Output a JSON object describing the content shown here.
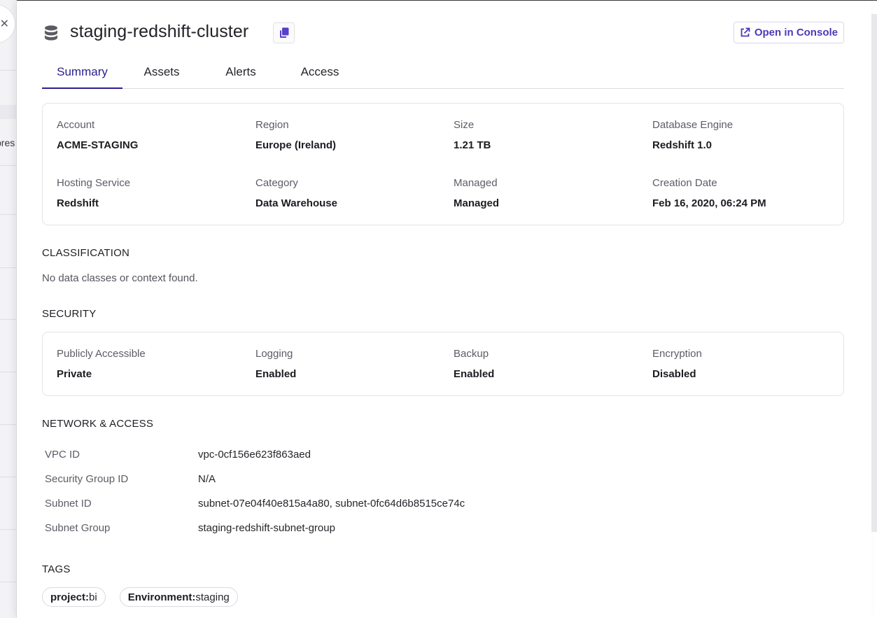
{
  "background": {
    "truncated_text": "pres"
  },
  "drawer": {
    "title": "staging-redshift-cluster",
    "open_console_label": "Open in Console",
    "tabs": [
      {
        "label": "Summary",
        "active": true
      },
      {
        "label": "Assets",
        "active": false
      },
      {
        "label": "Alerts",
        "active": false
      },
      {
        "label": "Access",
        "active": false
      }
    ],
    "overview": [
      {
        "label": "Account",
        "value": "ACME-STAGING"
      },
      {
        "label": "Region",
        "value": "Europe (Ireland)"
      },
      {
        "label": "Size",
        "value": "1.21 TB"
      },
      {
        "label": "Database Engine",
        "value": "Redshift 1.0"
      },
      {
        "label": "Hosting Service",
        "value": "Redshift"
      },
      {
        "label": "Category",
        "value": "Data Warehouse"
      },
      {
        "label": "Managed",
        "value": "Managed"
      },
      {
        "label": "Creation Date",
        "value": "Feb 16, 2020, 06:24 PM"
      }
    ],
    "classification": {
      "title": "CLASSIFICATION",
      "empty_text": "No data classes or context found."
    },
    "security": {
      "title": "SECURITY",
      "items": [
        {
          "label": "Publicly Accessible",
          "value": "Private"
        },
        {
          "label": "Logging",
          "value": "Enabled"
        },
        {
          "label": "Backup",
          "value": "Enabled"
        },
        {
          "label": "Encryption",
          "value": "Disabled"
        }
      ]
    },
    "network": {
      "title": "NETWORK & ACCESS",
      "rows": [
        {
          "key": "VPC ID",
          "value": "vpc-0cf156e623f863aed"
        },
        {
          "key": "Security Group ID",
          "value": "N/A"
        },
        {
          "key": "Subnet ID",
          "value": "subnet-07e04f40e815a4a80, subnet-0fc64d6b8515ce74c"
        },
        {
          "key": "Subnet Group",
          "value": "staging-redshift-subnet-group"
        }
      ]
    },
    "tags": {
      "title": "TAGS",
      "items": [
        {
          "key": "project:",
          "value": "bi"
        },
        {
          "key": "Environment:",
          "value": "staging"
        }
      ]
    }
  },
  "colors": {
    "accent": "#2a1f8c",
    "link": "#4b3ab8",
    "copy_icon": "#5a3fc8"
  },
  "icons": {
    "database": "database-icon",
    "copy": "copy-icon",
    "external_link": "external-link-icon",
    "close": "close-icon"
  }
}
